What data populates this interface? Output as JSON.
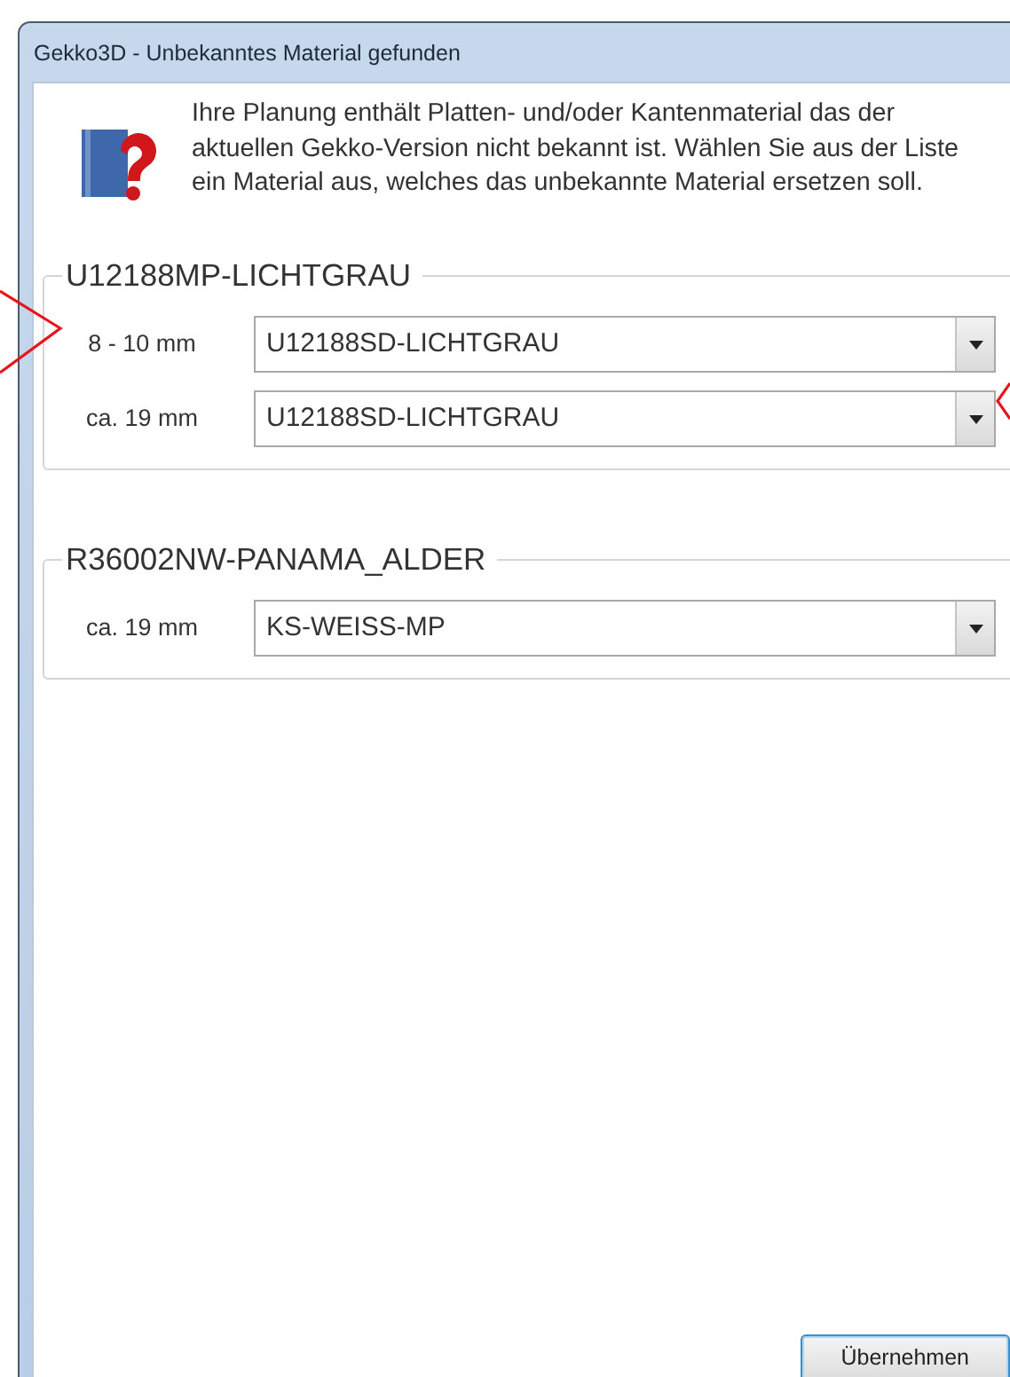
{
  "window": {
    "title": "Gekko3D - Unbekanntes Material gefunden"
  },
  "message": "Ihre Planung enthält Platten- und/oder Kantenmaterial das der aktuellen Gekko-Version nicht bekannt ist. Wählen Sie aus der Liste ein Material aus, welches das unbekannte Material ersetzen soll.",
  "groups": [
    {
      "title": "U12188MP-LICHTGRAU",
      "rows": [
        {
          "label": "8 - 10 mm",
          "value": "U12188SD-LICHTGRAU"
        },
        {
          "label": "ca. 19 mm",
          "value": "U12188SD-LICHTGRAU"
        }
      ]
    },
    {
      "title": "R36002NW-PANAMA_ALDER",
      "rows": [
        {
          "label": "ca. 19 mm",
          "value": "KS-WEISS-MP"
        }
      ]
    }
  ],
  "buttons": [
    "Übernehmen"
  ]
}
